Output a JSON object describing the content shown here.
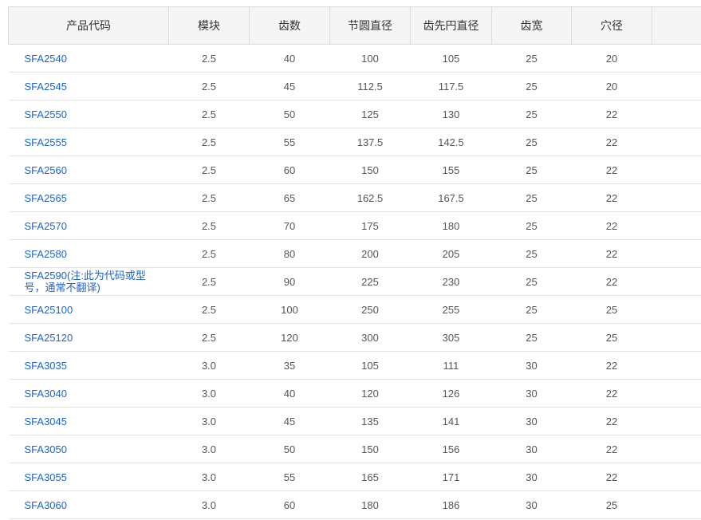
{
  "table": {
    "headers": [
      "产品代码",
      "模块",
      "齿数",
      "节圆直径",
      "齿先円直径",
      "齿宽",
      "穴径",
      ""
    ],
    "rows": [
      [
        "SFA2540",
        "2.5",
        "40",
        "100",
        "105",
        "25",
        "20"
      ],
      [
        "SFA2545",
        "2.5",
        "45",
        "112.5",
        "117.5",
        "25",
        "20"
      ],
      [
        "SFA2550",
        "2.5",
        "50",
        "125",
        "130",
        "25",
        "22"
      ],
      [
        "SFA2555",
        "2.5",
        "55",
        "137.5",
        "142.5",
        "25",
        "22"
      ],
      [
        "SFA2560",
        "2.5",
        "60",
        "150",
        "155",
        "25",
        "22"
      ],
      [
        "SFA2565",
        "2.5",
        "65",
        "162.5",
        "167.5",
        "25",
        "22"
      ],
      [
        "SFA2570",
        "2.5",
        "70",
        "175",
        "180",
        "25",
        "22"
      ],
      [
        "SFA2580",
        "2.5",
        "80",
        "200",
        "205",
        "25",
        "22"
      ],
      [
        "SFA2590(注:此为代码或型号，通常不翻译)",
        "2.5",
        "90",
        "225",
        "230",
        "25",
        "22"
      ],
      [
        "SFA25100",
        "2.5",
        "100",
        "250",
        "255",
        "25",
        "25"
      ],
      [
        "SFA25120",
        "2.5",
        "120",
        "300",
        "305",
        "25",
        "25"
      ],
      [
        "SFA3035",
        "3.0",
        "35",
        "105",
        "111",
        "30",
        "22"
      ],
      [
        "SFA3040",
        "3.0",
        "40",
        "120",
        "126",
        "30",
        "22"
      ],
      [
        "SFA3045",
        "3.0",
        "45",
        "135",
        "141",
        "30",
        "22"
      ],
      [
        "SFA3050",
        "3.0",
        "50",
        "150",
        "156",
        "30",
        "22"
      ],
      [
        "SFA3055",
        "3.0",
        "55",
        "165",
        "171",
        "30",
        "22"
      ],
      [
        "SFA3060",
        "3.0",
        "60",
        "180",
        "186",
        "30",
        "25"
      ]
    ],
    "colors": {
      "link": "#1e64c8",
      "text": "#555555",
      "header_bg": "#f5f5f5",
      "border": "#dcdcdc"
    }
  }
}
